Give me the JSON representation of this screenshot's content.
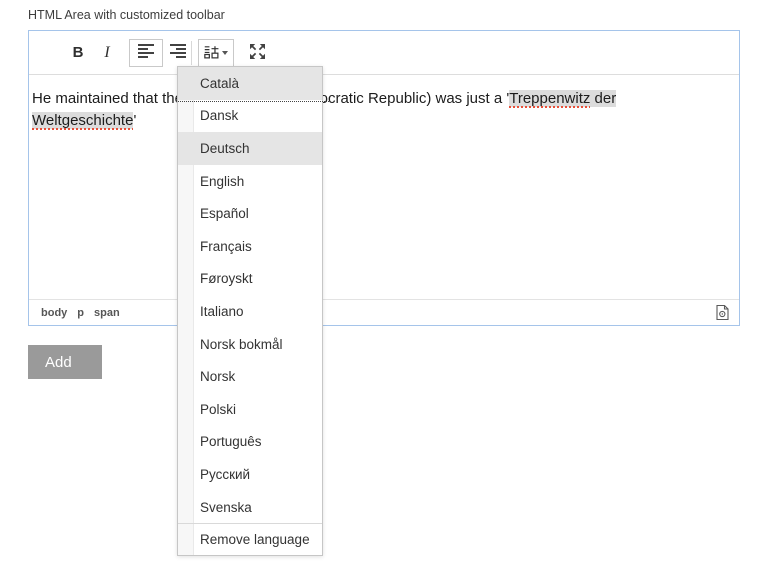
{
  "page": {
    "field_label": "HTML Area with customized toolbar"
  },
  "toolbar": {
    "bold_label": "B",
    "italic_label": "I"
  },
  "editor": {
    "content_runs": [
      {
        "text": "He maintained that the GDR (German Democratic Republic) was just a '",
        "style": "plain"
      },
      {
        "text": "Treppenwitz",
        "style": "selected misspelled"
      },
      {
        "text": " der ",
        "style": "selected"
      },
      {
        "text": "Weltgeschichte",
        "style": "selected misspelled"
      },
      {
        "text": "'",
        "style": "plain"
      }
    ],
    "status_path": [
      "body",
      "p",
      "span"
    ]
  },
  "language_menu": {
    "items": [
      {
        "label": "Català",
        "highlighted": true
      },
      {
        "label": "Dansk",
        "highlighted": false
      },
      {
        "label": "Deutsch",
        "highlighted": true
      },
      {
        "label": "English",
        "highlighted": false
      },
      {
        "label": "Español",
        "highlighted": false
      },
      {
        "label": "Français",
        "highlighted": false
      },
      {
        "label": "Føroyskt",
        "highlighted": false
      },
      {
        "label": "Italiano",
        "highlighted": false
      },
      {
        "label": "Norsk bokmål",
        "highlighted": false
      },
      {
        "label": "Norsk",
        "highlighted": false
      },
      {
        "label": "Polski",
        "highlighted": false
      },
      {
        "label": "Português",
        "highlighted": false
      },
      {
        "label": "Русский",
        "highlighted": false
      },
      {
        "label": "Svenska",
        "highlighted": false
      }
    ],
    "footer_label": "Remove language"
  },
  "actions": {
    "add_label": "Add"
  },
  "colors": {
    "focus_border": "#a5c4ea",
    "selection": "#dcdcdc",
    "menu_highlight": "#e5e5e5",
    "button_bg": "#9a9a9a",
    "spellcheck": "#e8503a",
    "dotted_line": "#444444"
  }
}
